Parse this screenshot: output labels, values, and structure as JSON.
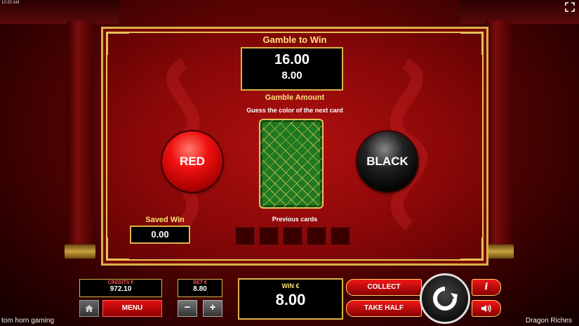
{
  "status": {
    "time": "10:20 AM"
  },
  "gamble": {
    "title": "Gamble to Win",
    "to_win": "16.00",
    "amount": "8.00",
    "amount_label": "Gamble Amount",
    "instruction": "Guess the color of the next card",
    "red_label": "RED",
    "black_label": "BLACK",
    "previous_label": "Previous cards",
    "previous_cards": [
      "",
      "",
      "",
      "",
      ""
    ]
  },
  "saved": {
    "label": "Saved Win",
    "value": "0.00"
  },
  "panel": {
    "credits_label": "CREDITS €",
    "credits_value": "972.10",
    "bet_label": "BET €",
    "bet_value": "8.80",
    "menu_label": "MENU",
    "minus_label": "−",
    "plus_label": "+",
    "win_label": "WIN €",
    "win_value": "8.00",
    "collect_label": "COLLECT",
    "take_half_label": "TAKE HALF",
    "info_label": "i"
  },
  "footer": {
    "brand": "tom horn gaming",
    "game": "Dragon Riches"
  },
  "icons": {
    "fullscreen": "fullscreen-icon",
    "home": "home-icon",
    "spin": "refresh-icon",
    "sound": "speaker-icon"
  },
  "colors": {
    "gold": "#d9b24a",
    "red": "#b01010",
    "label_gold": "#ffe27a"
  }
}
